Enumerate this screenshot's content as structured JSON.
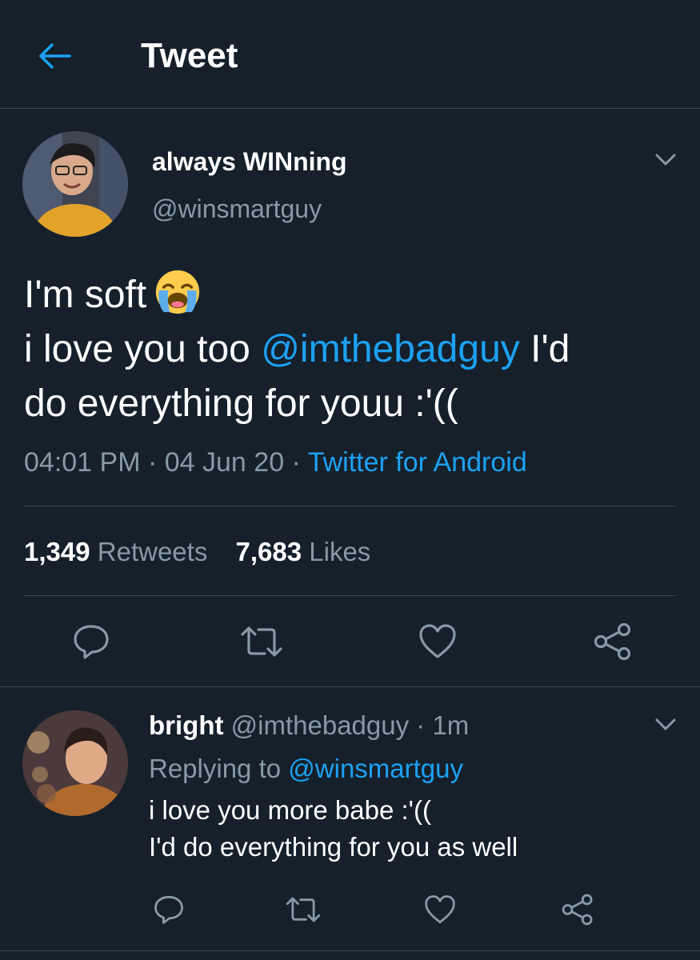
{
  "header": {
    "title": "Tweet",
    "back_icon": "arrow-left-icon"
  },
  "colors": {
    "background": "#15202b",
    "accent": "#1da1f2",
    "muted": "#8899a6",
    "divider": "#38444d"
  },
  "tweet": {
    "display_name": "always WINning",
    "handle": "@winsmartguy",
    "text_line1": "I'm soft",
    "emoji": "loudly-crying-face-emoji",
    "text_line2_before": "i love you too ",
    "mention": "@imthebadguy",
    "text_line2_after": " I'd",
    "text_line3": "do everything for youu :'((",
    "time": "04:01 PM",
    "date": "04 Jun 20",
    "source": "Twitter for Android",
    "retweets_count": "1,349",
    "retweets_label": "Retweets",
    "likes_count": "7,683",
    "likes_label": "Likes"
  },
  "reply": {
    "display_name": "bright",
    "handle": "@imthebadguy",
    "age": "1m",
    "replying_label": "Replying to",
    "replying_to": "@winsmartguy",
    "text_line1": "i love you more babe :'((",
    "text_line2": "I'd do everything for you as well"
  },
  "actions": {
    "icons": [
      "reply-icon",
      "retweet-icon",
      "like-icon",
      "share-icon"
    ]
  }
}
